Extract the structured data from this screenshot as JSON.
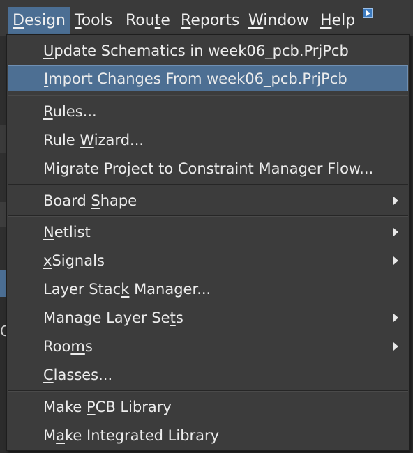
{
  "menubar": {
    "items": [
      {
        "pre": "",
        "key": "D",
        "post": "esign"
      },
      {
        "pre": "",
        "key": "T",
        "post": "ools"
      },
      {
        "pre": "Rou",
        "key": "t",
        "post": "e"
      },
      {
        "pre": "",
        "key": "R",
        "post": "eports"
      },
      {
        "pre": "",
        "key": "W",
        "post": "indow"
      },
      {
        "pre": "",
        "key": "H",
        "post": "elp"
      }
    ],
    "extra_icon": "play-small-icon"
  },
  "background": {
    "cut_text": "Cr"
  },
  "design_menu": {
    "items": [
      {
        "pre": "",
        "key": "U",
        "post": "pdate Schematics in week06_pcb.PrjPcb",
        "submenu": false
      },
      {
        "pre": "",
        "key": "I",
        "post": "mport Changes From week06_pcb.PrjPcb",
        "submenu": false,
        "highlighted": true
      },
      {
        "pre": "",
        "key": "R",
        "post": "ules...",
        "submenu": false
      },
      {
        "pre": "Rule ",
        "key": "W",
        "post": "izard...",
        "submenu": false
      },
      {
        "pre": "Migrate Project to Constraint Manager Flow...",
        "key": "",
        "post": "",
        "submenu": false
      },
      {
        "pre": "Board ",
        "key": "S",
        "post": "hape",
        "submenu": true
      },
      {
        "pre": "",
        "key": "N",
        "post": "etlist",
        "submenu": true
      },
      {
        "pre": "",
        "key": "x",
        "post": "Signals",
        "submenu": true
      },
      {
        "pre": "Layer Stac",
        "key": "k",
        "post": " Manager...",
        "submenu": false
      },
      {
        "pre": "Manage Layer Se",
        "key": "t",
        "post": "s",
        "submenu": true
      },
      {
        "pre": "Roo",
        "key": "m",
        "post": "s",
        "submenu": true
      },
      {
        "pre": "",
        "key": "C",
        "post": "lasses...",
        "submenu": false
      },
      {
        "pre": "Make ",
        "key": "P",
        "post": "CB Library",
        "submenu": false
      },
      {
        "pre": "M",
        "key": "a",
        "post": "ke Integrated Library",
        "submenu": false
      }
    ]
  },
  "colors": {
    "menu_bg": "#3c3c3c",
    "highlight": "#4d6f93",
    "menubar_active": "#4b6e93",
    "text": "#ececec"
  }
}
